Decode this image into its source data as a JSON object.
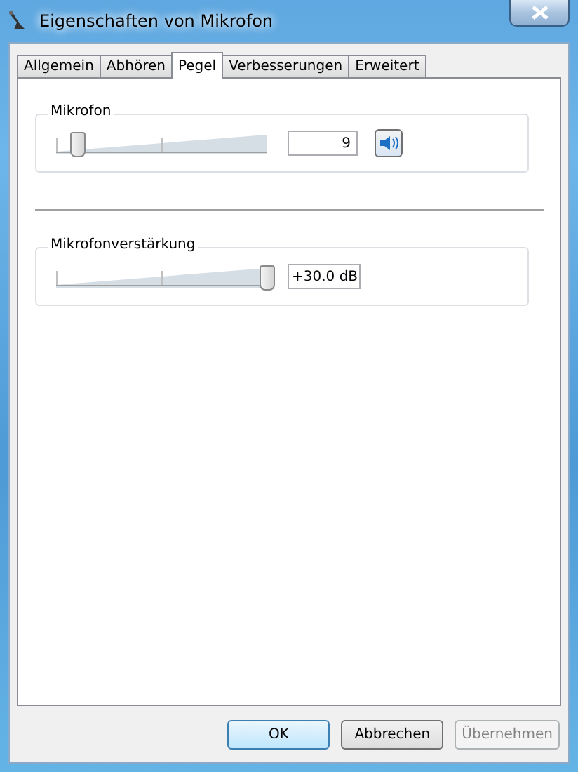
{
  "window": {
    "title": "Eigenschaften von Mikrofon"
  },
  "tabs": [
    {
      "label": "Allgemein",
      "selected": false
    },
    {
      "label": "Abhören",
      "selected": false
    },
    {
      "label": "Pegel",
      "selected": true
    },
    {
      "label": "Verbesserungen",
      "selected": false
    },
    {
      "label": "Erweitert",
      "selected": false
    }
  ],
  "groups": [
    {
      "title": "Mikrofon",
      "level": 0.09,
      "reading": "9",
      "mute": {
        "muted": false
      }
    },
    {
      "title": "Mikrofonverstärkung",
      "level": 1.0,
      "reading": "+30.0 dB"
    }
  ],
  "buttons": [
    {
      "label": "OK",
      "default": true,
      "disabled": false
    },
    {
      "label": "Abbrechen",
      "default": false,
      "disabled": false
    },
    {
      "label": "Übernehmen",
      "default": false,
      "disabled": true
    }
  ]
}
